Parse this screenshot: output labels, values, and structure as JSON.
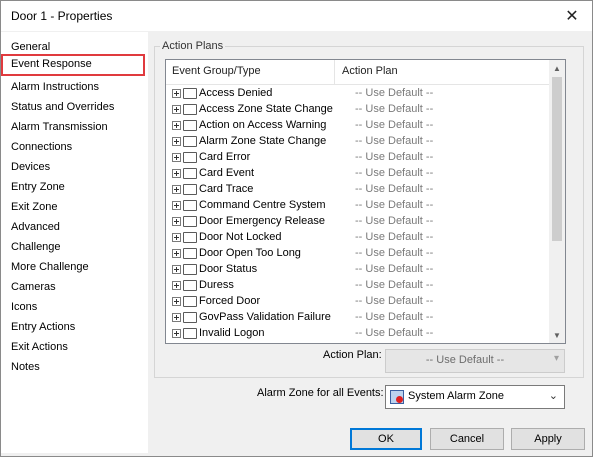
{
  "window": {
    "title": "Door 1 - Properties"
  },
  "nav": {
    "items": [
      {
        "label": "General"
      },
      {
        "label": "Event Response"
      },
      {
        "label": "Alarm Instructions"
      },
      {
        "label": "Status and Overrides"
      },
      {
        "label": "Alarm Transmission"
      },
      {
        "label": "Connections"
      },
      {
        "label": "Devices"
      },
      {
        "label": "Entry Zone"
      },
      {
        "label": "Exit Zone"
      },
      {
        "label": "Advanced"
      },
      {
        "label": "Challenge"
      },
      {
        "label": "More Challenge"
      },
      {
        "label": "Cameras"
      },
      {
        "label": "Icons"
      },
      {
        "label": "Entry Actions"
      },
      {
        "label": "Exit Actions"
      },
      {
        "label": "Notes"
      }
    ],
    "selected": "Event Response"
  },
  "action_plans": {
    "group_label": "Action Plans",
    "columns": [
      "Event Group/Type",
      "Action Plan"
    ],
    "rows": [
      {
        "event": "Access Denied",
        "plan": "-- Use Default --"
      },
      {
        "event": "Access Zone State Change",
        "plan": "-- Use Default --"
      },
      {
        "event": "Action on Access Warning",
        "plan": "-- Use Default --"
      },
      {
        "event": "Alarm Zone State Change",
        "plan": "-- Use Default --"
      },
      {
        "event": "Card Error",
        "plan": "-- Use Default --"
      },
      {
        "event": "Card Event",
        "plan": "-- Use Default --"
      },
      {
        "event": "Card Trace",
        "plan": "-- Use Default --"
      },
      {
        "event": "Command Centre System",
        "plan": "-- Use Default --"
      },
      {
        "event": "Door Emergency Release",
        "plan": "-- Use Default --"
      },
      {
        "event": "Door Not Locked",
        "plan": "-- Use Default --"
      },
      {
        "event": "Door Open Too Long",
        "plan": "-- Use Default --"
      },
      {
        "event": "Door Status",
        "plan": "-- Use Default --"
      },
      {
        "event": "Duress",
        "plan": "-- Use Default --"
      },
      {
        "event": "Forced Door",
        "plan": "-- Use Default --"
      },
      {
        "event": "GovPass Validation Failure",
        "plan": "-- Use Default --"
      },
      {
        "event": "Invalid Logon",
        "plan": "-- Use Default --"
      }
    ],
    "action_plan_label": "Action Plan:",
    "action_plan_value": "-- Use Default --"
  },
  "alarm_zone": {
    "label": "Alarm Zone for all Events:",
    "value": "System Alarm Zone"
  },
  "buttons": {
    "ok": "OK",
    "cancel": "Cancel",
    "apply": "Apply"
  },
  "colors": {
    "selection_border": "#e03a3e",
    "default_button_border": "#0078d7"
  }
}
